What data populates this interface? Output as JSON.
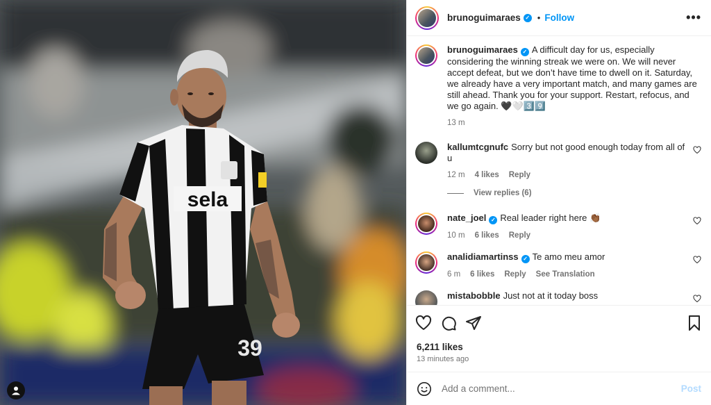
{
  "post": {
    "author": "brunoguimaraes",
    "header_separator": "•",
    "follow_label": "Follow",
    "more_label": "•••",
    "caption": "A difficult day for us, especially considering the winning streak we were on. We will never accept defeat, but we don’t have time to dwell on it. Saturday, we already have a very important match, and many games are still ahead. Thank you for your support. Restart, refocus, and we go again. 🖤🤍3️⃣9️⃣",
    "caption_time": "13 m",
    "likes": "6,211 likes",
    "posted_ago": "13 minutes ago",
    "jersey_sponsor": "sela",
    "jersey_number": "39"
  },
  "comments": [
    {
      "user": "kallumtcgnufc",
      "text": "Sorry but not good enough today from all of u",
      "time": "12 m",
      "likes": "4 likes",
      "reply": "Reply",
      "verified": false
    },
    {
      "user": "nate_joel",
      "text": "Real leader right here 👏🏾",
      "time": "10 m",
      "likes": "6 likes",
      "reply": "Reply",
      "verified": true
    },
    {
      "user": "analidiamartinss",
      "text": "Te amo meu amor",
      "time": "6 m",
      "likes": "6 likes",
      "reply": "Reply",
      "translate": "See Translation",
      "verified": true
    },
    {
      "user": "mistabobble",
      "text": "Just not at it today boss",
      "verified": false
    }
  ],
  "view_replies": "View replies (6)",
  "add_comment": {
    "placeholder": "Add a comment...",
    "post_label": "Post"
  },
  "icons": [
    "heart-icon",
    "comment-icon",
    "share-icon",
    "bookmark-icon",
    "emoji-icon",
    "user-tag-icon",
    "verified-icon",
    "more-icon"
  ],
  "colors": {
    "accent": "#0095f6",
    "verified": "#0095f6",
    "muted": "#737373",
    "post_disabled": "#b3dbff"
  }
}
